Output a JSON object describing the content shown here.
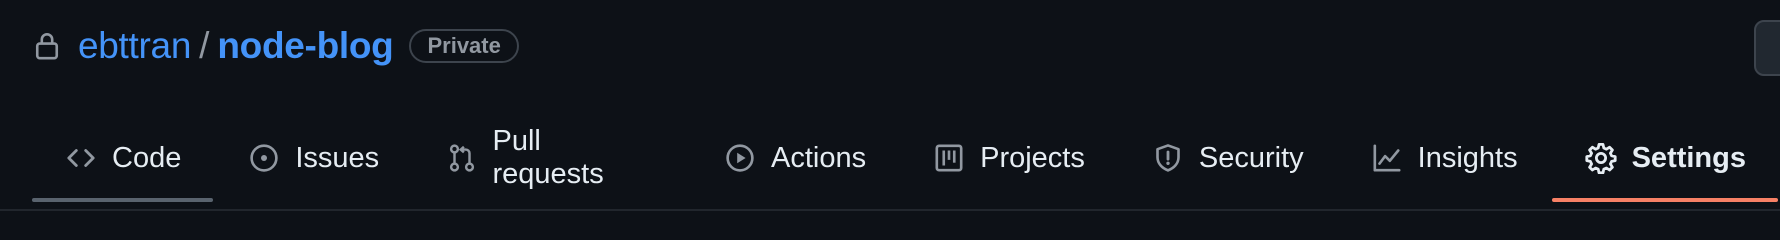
{
  "repo_header": {
    "owner": "ebttran",
    "separator": "/",
    "repo_name": "node-blog",
    "visibility": "Private",
    "lock_icon": "lock-icon"
  },
  "tabs": [
    {
      "id": "code",
      "label": "Code",
      "icon": "code-icon",
      "state": "hovered"
    },
    {
      "id": "issues",
      "label": "Issues",
      "icon": "issue-opened-icon",
      "state": "normal"
    },
    {
      "id": "pull-requests",
      "label": "Pull requests",
      "icon": "git-pull-request-icon",
      "state": "normal"
    },
    {
      "id": "actions",
      "label": "Actions",
      "icon": "play-icon",
      "state": "normal"
    },
    {
      "id": "projects",
      "label": "Projects",
      "icon": "table-icon",
      "state": "normal"
    },
    {
      "id": "security",
      "label": "Security",
      "icon": "shield-icon",
      "state": "normal"
    },
    {
      "id": "insights",
      "label": "Insights",
      "icon": "graph-icon",
      "state": "normal"
    },
    {
      "id": "settings",
      "label": "Settings",
      "icon": "gear-icon",
      "state": "selected"
    }
  ],
  "colors": {
    "background": "#0d1117",
    "link": "#4493f8",
    "text": "#e6edf3",
    "muted": "#9198a1",
    "selected_underline": "#f78166"
  }
}
